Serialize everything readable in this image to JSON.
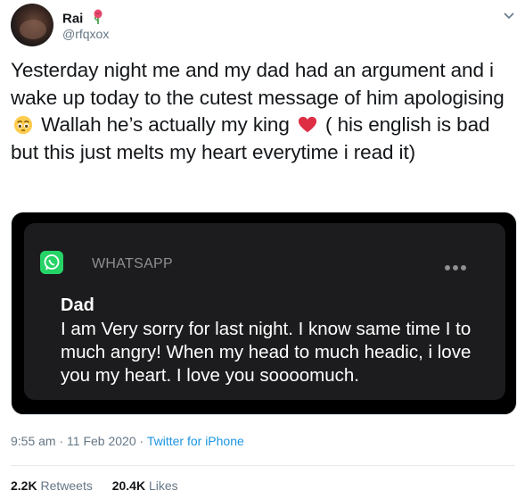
{
  "author": {
    "name": "Rai",
    "handle": "@rfqxox",
    "name_emoji": "rose-emoji"
  },
  "tweet": {
    "line1": "Yesterday night me and my dad had an argument and i wake up today to the cutest message of him apologising",
    "emoji1": "pleading-face-emoji",
    "line2": "Wallah he’s actually my king",
    "emoji2": "red-heart-emoji",
    "line3": "( his english is bad but this just melts my heart everytime i read it)"
  },
  "notification": {
    "app": "WHATSAPP",
    "sender": "Dad",
    "message": "I am Very sorry for last night. I know same time I to much angry! When my head to much headic, i love you my heart. I love you soooomuch."
  },
  "meta": {
    "time": "9:55 am",
    "separator": "·",
    "date": "11 Feb 2020",
    "source": "Twitter for iPhone"
  },
  "stats": {
    "retweets_count": "2.2K",
    "retweets_label": "Retweets",
    "likes_count": "20.4K",
    "likes_label": "Likes"
  },
  "colors": {
    "accent": "#1b95e0",
    "whatsapp": "#25d366",
    "heart": "#e0245e"
  }
}
